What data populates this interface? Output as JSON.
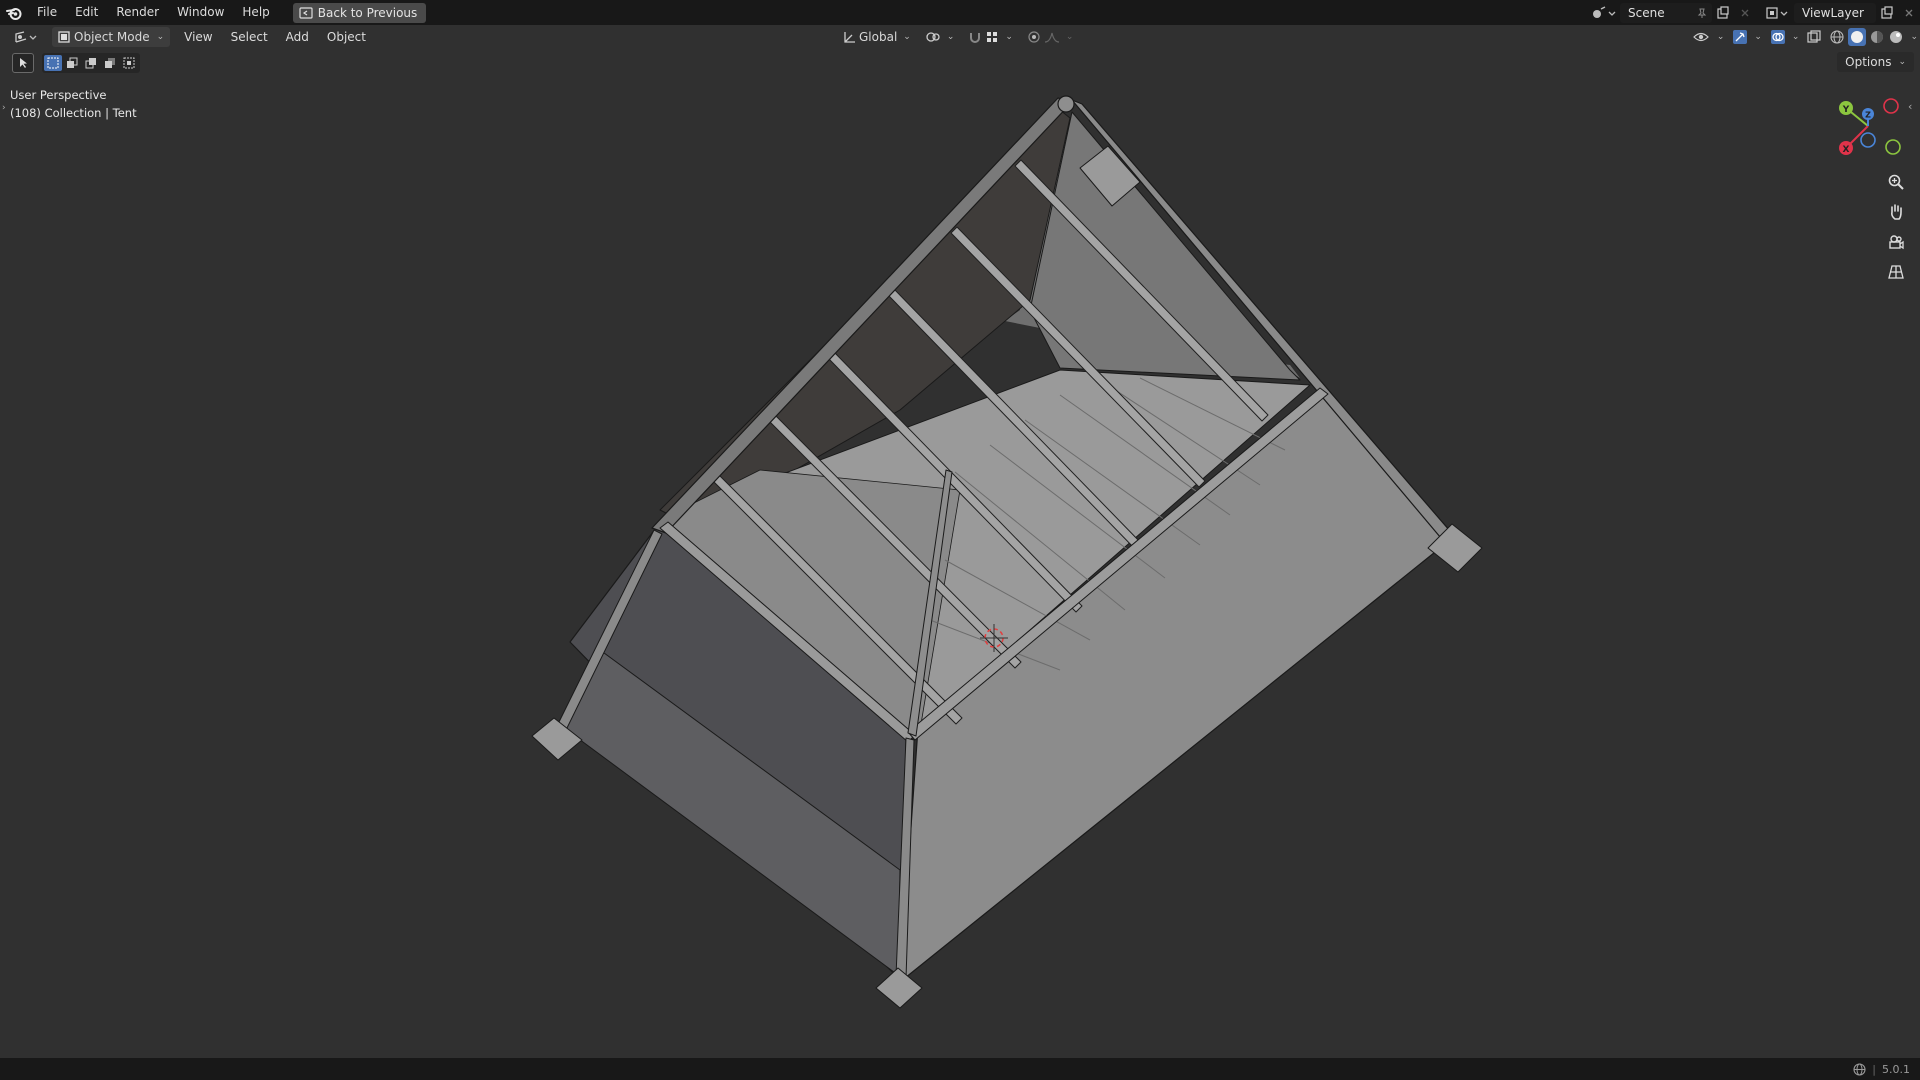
{
  "menubar": {
    "items": [
      "File",
      "Edit",
      "Render",
      "Window",
      "Help"
    ],
    "back_button": "Back to Previous"
  },
  "top_right": {
    "scene_name": "Scene",
    "view_layer": "ViewLayer"
  },
  "viewport_header": {
    "mode": "Object Mode",
    "menus": [
      "View",
      "Select",
      "Add",
      "Object"
    ],
    "transform_orientation": "Global",
    "options_label": "Options"
  },
  "viewport": {
    "perspective_label": "User Perspective",
    "object_info": "(108) Collection | Tent"
  },
  "gizmo": {
    "axis_y": "Y",
    "axis_z": "Z",
    "axis_x": "X",
    "colors": {
      "x": "#e0334a",
      "y": "#8cc63f",
      "z": "#4a85d8"
    }
  },
  "statusbar": {
    "version": "5.0.1"
  },
  "colors": {
    "topbar": "#181818",
    "viewport_bg": "#303030",
    "accent": "#4772b3"
  }
}
